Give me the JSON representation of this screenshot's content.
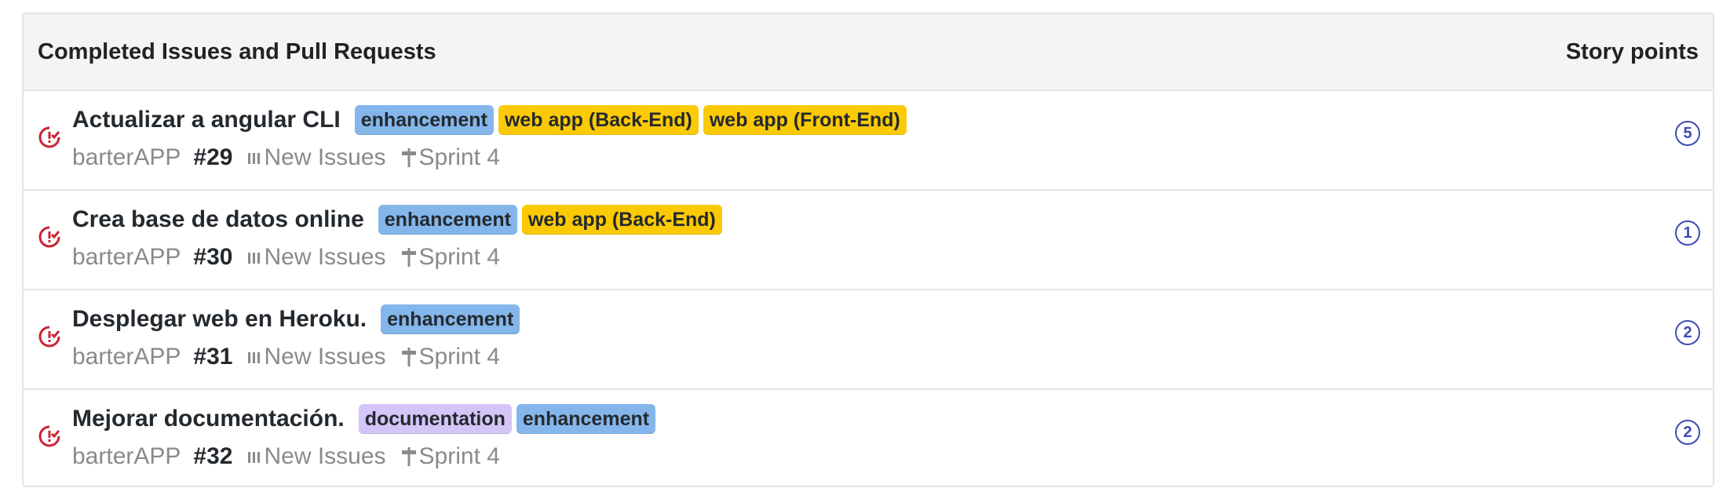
{
  "header": {
    "title": "Completed Issues and Pull Requests",
    "points_label": "Story points"
  },
  "colors": {
    "enhancement": "#84b6eb",
    "web app (Back-End)": "#fbca04",
    "web app (Front-End)": "#fbca04",
    "documentation": "#d4c5f9",
    "closed_icon": "#cb2431",
    "points": "#3f4bb0"
  },
  "issues": [
    {
      "title": "Actualizar a angular CLI",
      "labels": [
        "enhancement",
        "web app (Back-End)",
        "web app (Front-End)"
      ],
      "repo": "barterAPP",
      "number": "#29",
      "column": "New Issues",
      "milestone": "Sprint 4",
      "points": "5"
    },
    {
      "title": "Crea base de datos online",
      "labels": [
        "enhancement",
        "web app (Back-End)"
      ],
      "repo": "barterAPP",
      "number": "#30",
      "column": "New Issues",
      "milestone": "Sprint 4",
      "points": "1"
    },
    {
      "title": "Desplegar web en Heroku.",
      "labels": [
        "enhancement"
      ],
      "repo": "barterAPP",
      "number": "#31",
      "column": "New Issues",
      "milestone": "Sprint 4",
      "points": "2"
    },
    {
      "title": "Mejorar documentación.",
      "labels": [
        "documentation",
        "enhancement"
      ],
      "repo": "barterAPP",
      "number": "#32",
      "column": "New Issues",
      "milestone": "Sprint 4",
      "points": "2"
    }
  ]
}
